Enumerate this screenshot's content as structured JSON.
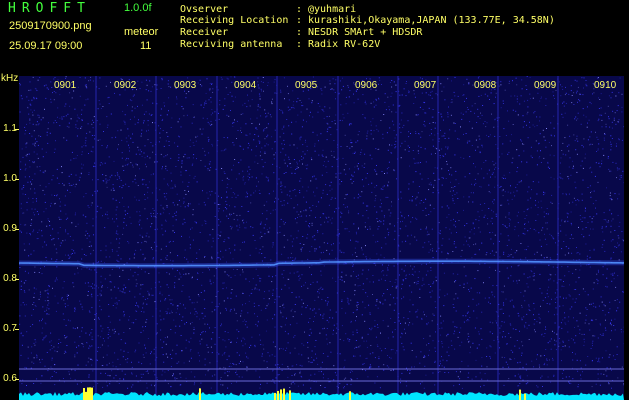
{
  "header": {
    "app_title": "HROFFT",
    "version": "1.0.0f",
    "filename": "2509170900.png",
    "datetime": "25.09.17 09:00",
    "count_label": "meteor",
    "count_value": "11"
  },
  "info": [
    {
      "key": "Ovserver",
      "sep": ":",
      "value": "@yuhmari"
    },
    {
      "key": "Receiving Location",
      "sep": ":",
      "value": "kurashiki,Okayama,JAPAN (133.77E, 34.58N)"
    },
    {
      "key": "Receiver",
      "sep": ":",
      "value": "NESDR SMArt + HDSDR"
    },
    {
      "key": "Recviving antenna",
      "sep": ":",
      "value": "Radix RV-62V"
    }
  ],
  "spectrogram": {
    "unit": "kHz",
    "y_ticks": [
      "1.1",
      "1.0",
      "0.9",
      "0.8",
      "0.7",
      "0.6"
    ],
    "x_ticks": [
      "0901",
      "0902",
      "0903",
      "0904",
      "0905",
      "0906",
      "0907",
      "0908",
      "0909",
      "0910"
    ],
    "colors": {
      "background": "#08084a",
      "noise": "#3b3bff",
      "trace": "#5fb0ff",
      "gridline": "#6a6ad8",
      "signal_bar": "#00e5ff",
      "spike": "#ffff33",
      "label": "#ffff66",
      "title": "#43ff3d"
    }
  }
}
